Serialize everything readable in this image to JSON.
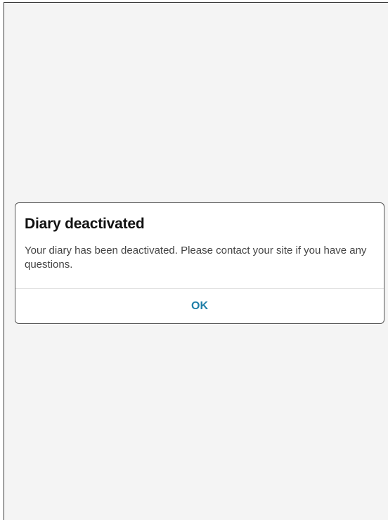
{
  "dialog": {
    "title": "Diary deactivated",
    "message": "Your diary has been deactivated. Please contact your site if you have any questions.",
    "ok_label": "OK"
  },
  "colors": {
    "background": "#f4f4f4",
    "dialog_background": "#ffffff",
    "button_text": "#1f7fa8"
  }
}
